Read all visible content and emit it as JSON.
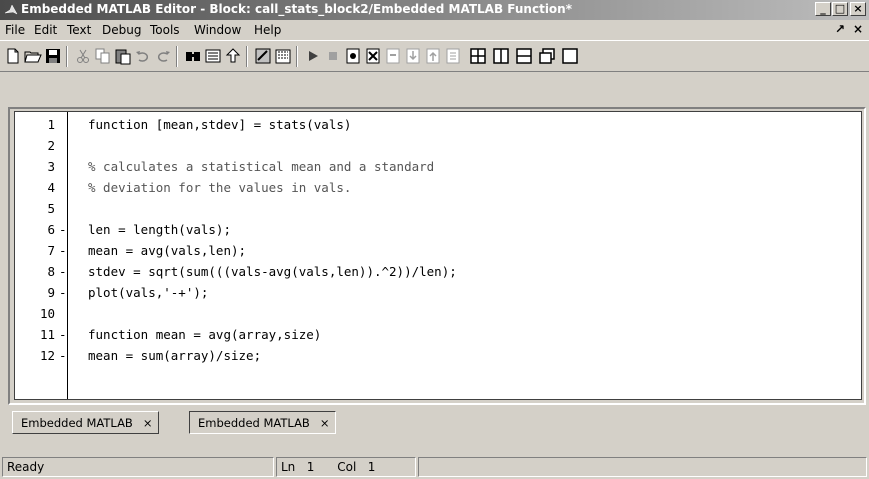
{
  "window": {
    "title": "Embedded MATLAB Editor - Block: call_stats_block2/Embedded MATLAB Function*",
    "buttons": {
      "minimize": "_",
      "maximize": "□",
      "close": "×"
    }
  },
  "menubar": {
    "items": [
      "File",
      "Edit",
      "Text",
      "Debug",
      "Tools",
      "Window",
      "Help"
    ],
    "undock": "↗",
    "close": "×"
  },
  "toolbar": {
    "icons": [
      "new-file-icon",
      "open-folder-icon",
      "save-icon",
      "cut-icon",
      "copy-icon",
      "paste-icon",
      "undo-icon",
      "redo-icon",
      "find-icon",
      "show-functions-icon",
      "go-to-parent-icon",
      "update-diagram-icon",
      "build-icon",
      "run-icon",
      "stop-icon",
      "set-breakpoint-icon",
      "clear-breakpoints-icon",
      "step-icon",
      "step-in-icon",
      "step-out-icon",
      "exit-debug-icon",
      "tile-icon",
      "split-vertical-icon",
      "split-horizontal-icon",
      "restore-icon",
      "maximize-icon"
    ]
  },
  "editor": {
    "lines": [
      {
        "num": "1",
        "bp": "",
        "code": "function [mean,stdev] = stats(vals)",
        "comment": false
      },
      {
        "num": "2",
        "bp": "",
        "code": "",
        "comment": false
      },
      {
        "num": "3",
        "bp": "",
        "code": "% calculates a statistical mean and a standard",
        "comment": true
      },
      {
        "num": "4",
        "bp": "",
        "code": "% deviation for the values in vals.",
        "comment": true
      },
      {
        "num": "5",
        "bp": "",
        "code": "",
        "comment": false
      },
      {
        "num": "6",
        "bp": "-",
        "code": "len = length(vals);",
        "comment": false
      },
      {
        "num": "7",
        "bp": "-",
        "code": "mean = avg(vals,len);",
        "comment": false
      },
      {
        "num": "8",
        "bp": "-",
        "code": "stdev = sqrt(sum(((vals-avg(vals,len)).^2))/len);",
        "comment": false
      },
      {
        "num": "9",
        "bp": "-",
        "code": "plot(vals,'-+');",
        "comment": false
      },
      {
        "num": "10",
        "bp": "",
        "code": "",
        "comment": false
      },
      {
        "num": "11",
        "bp": "-",
        "code": "function mean = avg(array,size)",
        "comment": false
      },
      {
        "num": "12",
        "bp": "-",
        "code": "mean = sum(array)/size;",
        "comment": false
      }
    ]
  },
  "tabs": [
    {
      "label": "Embedded MATLAB",
      "close": "×"
    },
    {
      "label": "Embedded MATLAB",
      "close": "×"
    }
  ],
  "status": {
    "state": "Ready",
    "ln_label": "Ln",
    "ln": "1",
    "col_label": "Col",
    "col": "1"
  }
}
